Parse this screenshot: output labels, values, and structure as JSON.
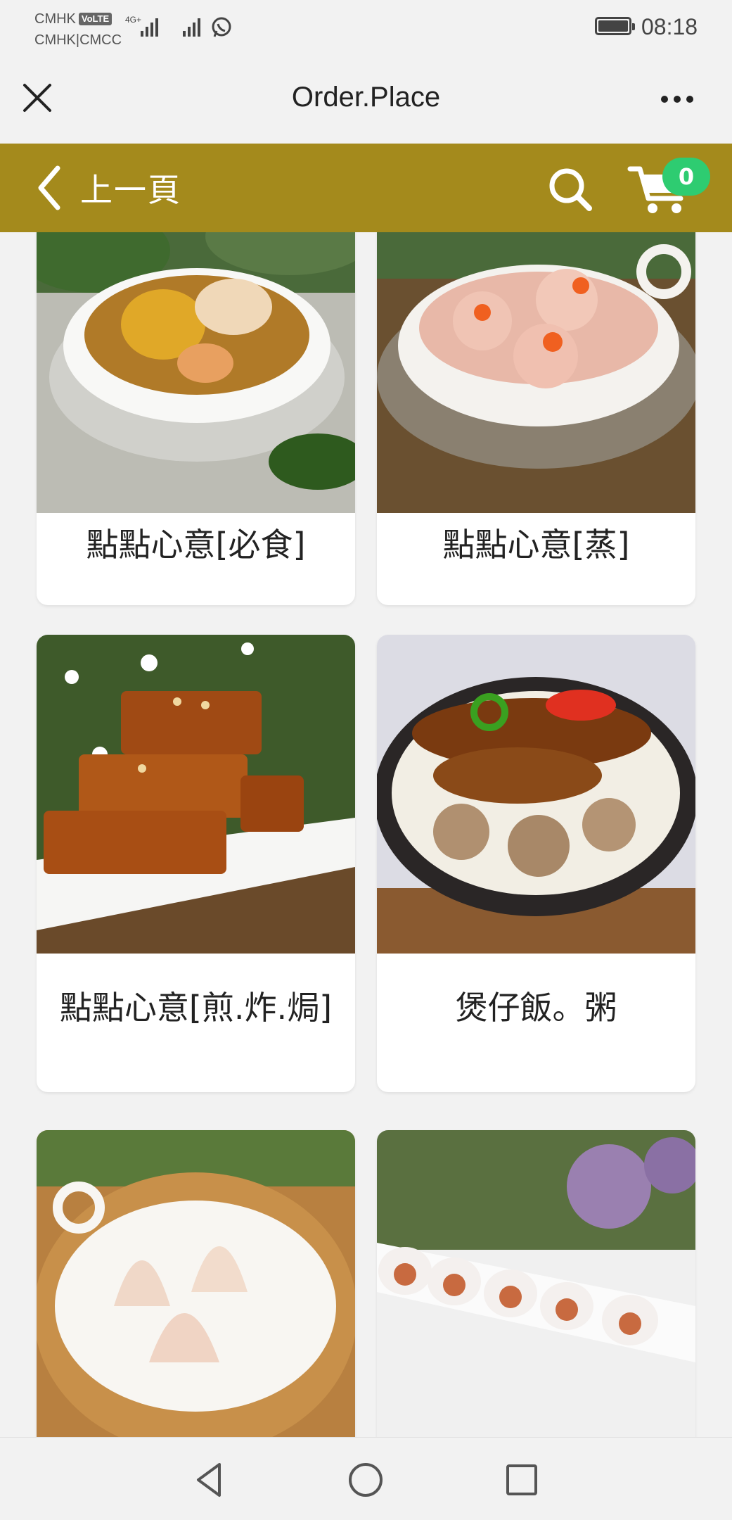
{
  "status_bar": {
    "carrier_line1": "CMHK",
    "volte": "VoLTE",
    "carrier_line2": "CMHK|CMCC",
    "network": "4G+",
    "time": "08:18"
  },
  "title_bar": {
    "title": "Order.Place"
  },
  "header": {
    "back_label": "上一頁",
    "cart_count": "0",
    "accent_color": "#a48a1c",
    "badge_color": "#2ecc71"
  },
  "menu": {
    "categories": [
      {
        "label": "點點心意[必食]",
        "image": "soup-bowl-photo"
      },
      {
        "label": "點點心意[蒸]",
        "image": "shrimp-dumplings-photo"
      },
      {
        "label": "點點心意[煎.炸.焗]",
        "image": "water-chestnut-cake-photo"
      },
      {
        "label": "煲仔飯。粥",
        "image": "claypot-rice-photo"
      },
      {
        "label": "",
        "image": "siu-mai-basket-photo"
      },
      {
        "label": "",
        "image": "rice-rolls-plate-photo"
      }
    ]
  }
}
